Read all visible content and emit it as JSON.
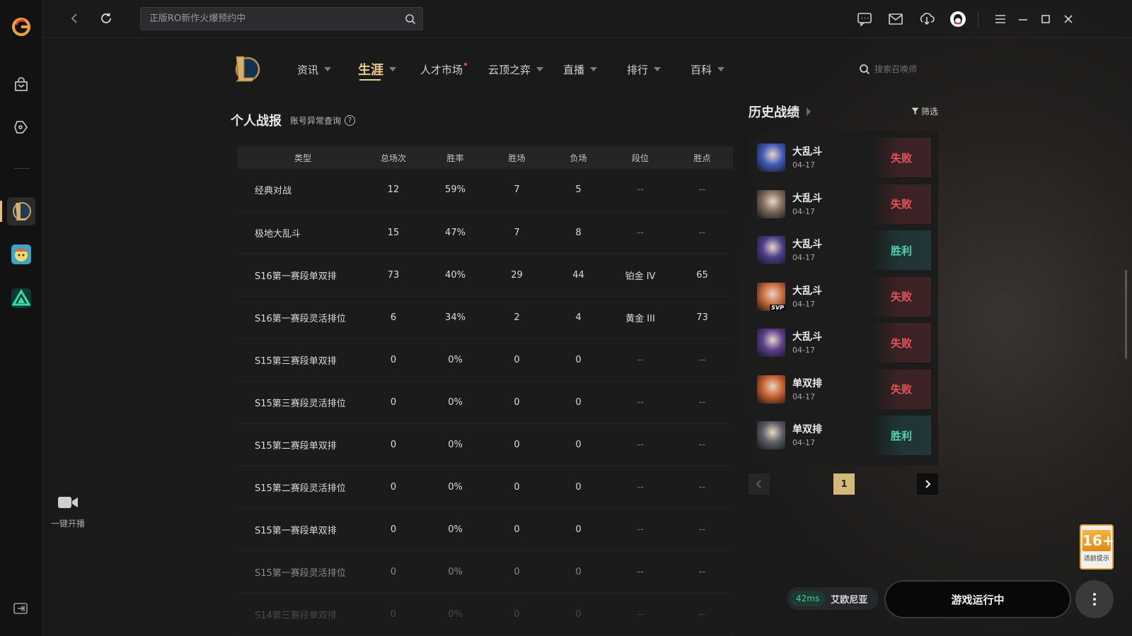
{
  "search": {
    "placeholder": "正版RO新作火爆预约中"
  },
  "sidebar": {
    "live_label": "一键开播"
  },
  "topnav": {
    "items": [
      {
        "label": "资讯"
      },
      {
        "label": "生涯"
      },
      {
        "label": "人才市场"
      },
      {
        "label": "云顶之弈"
      },
      {
        "label": "直播"
      },
      {
        "label": "排行"
      },
      {
        "label": "百科"
      }
    ],
    "active": "生涯",
    "summoner_search_placeholder": "搜索召唤师"
  },
  "stats": {
    "title": "个人战报",
    "abnormal_link": "账号异常查询",
    "help_mark": "?",
    "headers": [
      "类型",
      "总场次",
      "胜率",
      "胜场",
      "负场",
      "段位",
      "胜点"
    ],
    "rows": [
      [
        "经典对战",
        "12",
        "59%",
        "7",
        "5",
        "--",
        "--"
      ],
      [
        "极地大乱斗",
        "15",
        "47%",
        "7",
        "8",
        "--",
        "--"
      ],
      [
        "S16第一赛段单双排",
        "73",
        "40%",
        "29",
        "44",
        "铂金 IV",
        "65"
      ],
      [
        "S16第一赛段灵活排位",
        "6",
        "34%",
        "2",
        "4",
        "黄金 III",
        "73"
      ],
      [
        "S15第三赛段单双排",
        "0",
        "0%",
        "0",
        "0",
        "--",
        "--"
      ],
      [
        "S15第三赛段灵活排位",
        "0",
        "0%",
        "0",
        "0",
        "--",
        "--"
      ],
      [
        "S15第二赛段单双排",
        "0",
        "0%",
        "0",
        "0",
        "--",
        "--"
      ],
      [
        "S15第二赛段灵活排位",
        "0",
        "0%",
        "0",
        "0",
        "--",
        "--"
      ],
      [
        "S15第一赛段单双排",
        "0",
        "0%",
        "0",
        "0",
        "--",
        "--"
      ],
      [
        "S15第一赛段灵活排位",
        "0",
        "0%",
        "0",
        "0",
        "--",
        "--"
      ],
      [
        "S14第三赛段单双排",
        "0",
        "0%",
        "0",
        "0",
        "--",
        "--"
      ]
    ]
  },
  "history": {
    "title": "历史战绩",
    "filter_label": "筛选",
    "matches": [
      {
        "mode": "大乱斗",
        "date": "04-17",
        "result": "失败",
        "outcome": "loss",
        "champ_color": "#3f5ab8"
      },
      {
        "mode": "大乱斗",
        "date": "04-17",
        "result": "失败",
        "outcome": "loss",
        "champ_color": "#7a6a5c"
      },
      {
        "mode": "大乱斗",
        "date": "04-17",
        "result": "胜利",
        "outcome": "win",
        "champ_color": "#4b3d8a"
      },
      {
        "mode": "大乱斗",
        "date": "04-17",
        "result": "失败",
        "outcome": "loss",
        "champ_color": "#c86a3a",
        "badge": "SVP"
      },
      {
        "mode": "大乱斗",
        "date": "04-17",
        "result": "失败",
        "outcome": "loss",
        "champ_color": "#5a3f8c"
      },
      {
        "mode": "单双排",
        "date": "04-17",
        "result": "失败",
        "outcome": "loss",
        "champ_color": "#c8602e"
      },
      {
        "mode": "单双排",
        "date": "04-17",
        "result": "胜利",
        "outcome": "win",
        "champ_color": "#5b5d66"
      }
    ],
    "page": "1"
  },
  "age_badge": {
    "age": "16+",
    "caption": "适龄提示"
  },
  "footer": {
    "ping": "42ms",
    "server": "艾欧尼亚",
    "run_label": "游戏运行中"
  },
  "colors": {
    "accent": "#e8cc8e",
    "win": "#4fd3b5",
    "loss": "#e8525a"
  }
}
